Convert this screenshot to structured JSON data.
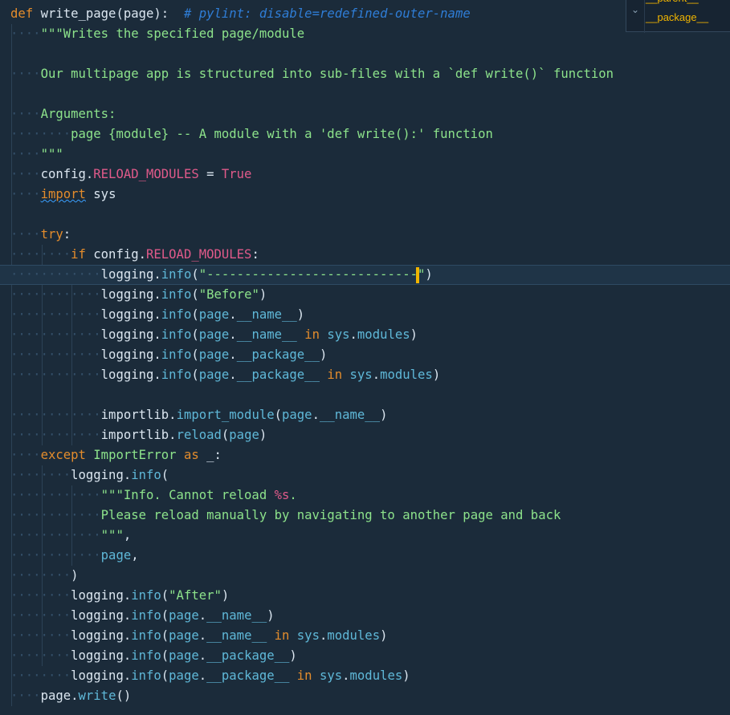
{
  "editor": {
    "lines": [
      {
        "indent": 0,
        "tokens": [
          [
            "kw",
            "def"
          ],
          [
            "id",
            " "
          ],
          [
            "fn",
            "write_page"
          ],
          [
            "punc",
            "("
          ],
          [
            "id",
            "page"
          ],
          [
            "punc",
            "):"
          ],
          [
            "id",
            "  "
          ],
          [
            "comment",
            "# pylint: disable=redefined-outer-name"
          ]
        ]
      },
      {
        "indent": 1,
        "tokens": [
          [
            "str",
            "\"\"\"Writes the specified page/module"
          ]
        ]
      },
      {
        "indent": 0,
        "tokens": []
      },
      {
        "indent": 1,
        "tokens": [
          [
            "str",
            "Our multipage app is structured into sub-files with a `def write()` function"
          ]
        ]
      },
      {
        "indent": 0,
        "tokens": []
      },
      {
        "indent": 1,
        "tokens": [
          [
            "str",
            "Arguments:"
          ]
        ]
      },
      {
        "indent": 2,
        "tokens": [
          [
            "str",
            "page {module} -- A module with a 'def write():' function"
          ]
        ]
      },
      {
        "indent": 1,
        "tokens": [
          [
            "str",
            "\"\"\""
          ]
        ]
      },
      {
        "indent": 1,
        "tokens": [
          [
            "id",
            "config."
          ],
          [
            "const",
            "RELOAD_MODULES"
          ],
          [
            "punc",
            " = "
          ],
          [
            "true",
            "True"
          ]
        ]
      },
      {
        "indent": 1,
        "tokens": [
          [
            "kw squiggle",
            "import"
          ],
          [
            "id",
            " sys"
          ]
        ]
      },
      {
        "indent": 0,
        "tokens": []
      },
      {
        "indent": 1,
        "tokens": [
          [
            "kw",
            "try"
          ],
          [
            "punc",
            ":"
          ]
        ]
      },
      {
        "indent": 2,
        "tokens": [
          [
            "kw",
            "if"
          ],
          [
            "id",
            " config."
          ],
          [
            "const",
            "RELOAD_MODULES"
          ],
          [
            "punc",
            ":"
          ]
        ]
      },
      {
        "indent": 3,
        "current": true,
        "tokens": [
          [
            "id",
            "logging."
          ],
          [
            "call",
            "info"
          ],
          [
            "punc",
            "("
          ],
          [
            "str",
            "\"----------------------------"
          ],
          [
            "cursor",
            ""
          ],
          [
            "str",
            "\""
          ],
          [
            "punc",
            ")"
          ]
        ]
      },
      {
        "indent": 3,
        "tokens": [
          [
            "id",
            "logging."
          ],
          [
            "call",
            "info"
          ],
          [
            "punc",
            "("
          ],
          [
            "str",
            "\"Before\""
          ],
          [
            "punc",
            ")"
          ]
        ]
      },
      {
        "indent": 3,
        "tokens": [
          [
            "id",
            "logging."
          ],
          [
            "call",
            "info"
          ],
          [
            "punc",
            "("
          ],
          [
            "call",
            "page"
          ],
          [
            "punc",
            "."
          ],
          [
            "call",
            "__name__"
          ],
          [
            "punc",
            ")"
          ]
        ]
      },
      {
        "indent": 3,
        "tokens": [
          [
            "id",
            "logging."
          ],
          [
            "call",
            "info"
          ],
          [
            "punc",
            "("
          ],
          [
            "call",
            "page"
          ],
          [
            "punc",
            "."
          ],
          [
            "call",
            "__name__"
          ],
          [
            "id",
            " "
          ],
          [
            "kw",
            "in"
          ],
          [
            "id",
            " "
          ],
          [
            "call",
            "sys"
          ],
          [
            "punc",
            "."
          ],
          [
            "call",
            "modules"
          ],
          [
            "punc",
            ")"
          ]
        ]
      },
      {
        "indent": 3,
        "tokens": [
          [
            "id",
            "logging."
          ],
          [
            "call",
            "info"
          ],
          [
            "punc",
            "("
          ],
          [
            "call",
            "page"
          ],
          [
            "punc",
            "."
          ],
          [
            "call",
            "__package__"
          ],
          [
            "punc",
            ")"
          ]
        ]
      },
      {
        "indent": 3,
        "tokens": [
          [
            "id",
            "logging."
          ],
          [
            "call",
            "info"
          ],
          [
            "punc",
            "("
          ],
          [
            "call",
            "page"
          ],
          [
            "punc",
            "."
          ],
          [
            "call",
            "__package__"
          ],
          [
            "id",
            " "
          ],
          [
            "kw",
            "in"
          ],
          [
            "id",
            " "
          ],
          [
            "call",
            "sys"
          ],
          [
            "punc",
            "."
          ],
          [
            "call",
            "modules"
          ],
          [
            "punc",
            ")"
          ]
        ]
      },
      {
        "indent": 0,
        "tokens": []
      },
      {
        "indent": 3,
        "tokens": [
          [
            "id",
            "importlib."
          ],
          [
            "call",
            "import_module"
          ],
          [
            "punc",
            "("
          ],
          [
            "call",
            "page"
          ],
          [
            "punc",
            "."
          ],
          [
            "call",
            "__name__"
          ],
          [
            "punc",
            ")"
          ]
        ]
      },
      {
        "indent": 3,
        "tokens": [
          [
            "id",
            "importlib."
          ],
          [
            "call",
            "reload"
          ],
          [
            "punc",
            "("
          ],
          [
            "call",
            "page"
          ],
          [
            "punc",
            ")"
          ]
        ]
      },
      {
        "indent": 1,
        "tokens": [
          [
            "kw",
            "except"
          ],
          [
            "id",
            " "
          ],
          [
            "cls",
            "ImportError"
          ],
          [
            "id",
            " "
          ],
          [
            "kw",
            "as"
          ],
          [
            "id",
            " _:"
          ]
        ]
      },
      {
        "indent": 2,
        "tokens": [
          [
            "id",
            "logging."
          ],
          [
            "call",
            "info"
          ],
          [
            "punc",
            "("
          ]
        ]
      },
      {
        "indent": 3,
        "tokens": [
          [
            "str",
            "\"\"\"Info. Cannot reload "
          ],
          [
            "const",
            "%s"
          ],
          [
            "str",
            "."
          ]
        ]
      },
      {
        "indent": 3,
        "tokens": [
          [
            "str",
            "Please reload manually by navigating to another page and back"
          ]
        ]
      },
      {
        "indent": 3,
        "tokens": [
          [
            "str",
            "\"\"\""
          ],
          [
            "punc",
            ","
          ]
        ]
      },
      {
        "indent": 3,
        "tokens": [
          [
            "call",
            "page"
          ],
          [
            "punc",
            ","
          ]
        ]
      },
      {
        "indent": 2,
        "tokens": [
          [
            "punc",
            ")"
          ]
        ]
      },
      {
        "indent": 2,
        "tokens": [
          [
            "id",
            "logging."
          ],
          [
            "call",
            "info"
          ],
          [
            "punc",
            "("
          ],
          [
            "str",
            "\"After\""
          ],
          [
            "punc",
            ")"
          ]
        ]
      },
      {
        "indent": 2,
        "tokens": [
          [
            "id",
            "logging."
          ],
          [
            "call",
            "info"
          ],
          [
            "punc",
            "("
          ],
          [
            "call",
            "page"
          ],
          [
            "punc",
            "."
          ],
          [
            "call",
            "__name__"
          ],
          [
            "punc",
            ")"
          ]
        ]
      },
      {
        "indent": 2,
        "tokens": [
          [
            "id",
            "logging."
          ],
          [
            "call",
            "info"
          ],
          [
            "punc",
            "("
          ],
          [
            "call",
            "page"
          ],
          [
            "punc",
            "."
          ],
          [
            "call",
            "__name__"
          ],
          [
            "id",
            " "
          ],
          [
            "kw",
            "in"
          ],
          [
            "id",
            " "
          ],
          [
            "call",
            "sys"
          ],
          [
            "punc",
            "."
          ],
          [
            "call",
            "modules"
          ],
          [
            "punc",
            ")"
          ]
        ]
      },
      {
        "indent": 2,
        "tokens": [
          [
            "id",
            "logging."
          ],
          [
            "call",
            "info"
          ],
          [
            "punc",
            "("
          ],
          [
            "call",
            "page"
          ],
          [
            "punc",
            "."
          ],
          [
            "call",
            "__package__"
          ],
          [
            "punc",
            ")"
          ]
        ]
      },
      {
        "indent": 2,
        "tokens": [
          [
            "id",
            "logging."
          ],
          [
            "call",
            "info"
          ],
          [
            "punc",
            "("
          ],
          [
            "call",
            "page"
          ],
          [
            "punc",
            "."
          ],
          [
            "call",
            "__package__"
          ],
          [
            "id",
            " "
          ],
          [
            "kw",
            "in"
          ],
          [
            "id",
            " "
          ],
          [
            "call",
            "sys"
          ],
          [
            "punc",
            "."
          ],
          [
            "call",
            "modules"
          ],
          [
            "punc",
            ")"
          ]
        ]
      },
      {
        "indent": 1,
        "tokens": [
          [
            "id",
            "page."
          ],
          [
            "call",
            "write"
          ],
          [
            "punc",
            "()"
          ]
        ]
      }
    ]
  },
  "autocomplete": {
    "items": [
      "__parent__",
      "__package__"
    ]
  }
}
